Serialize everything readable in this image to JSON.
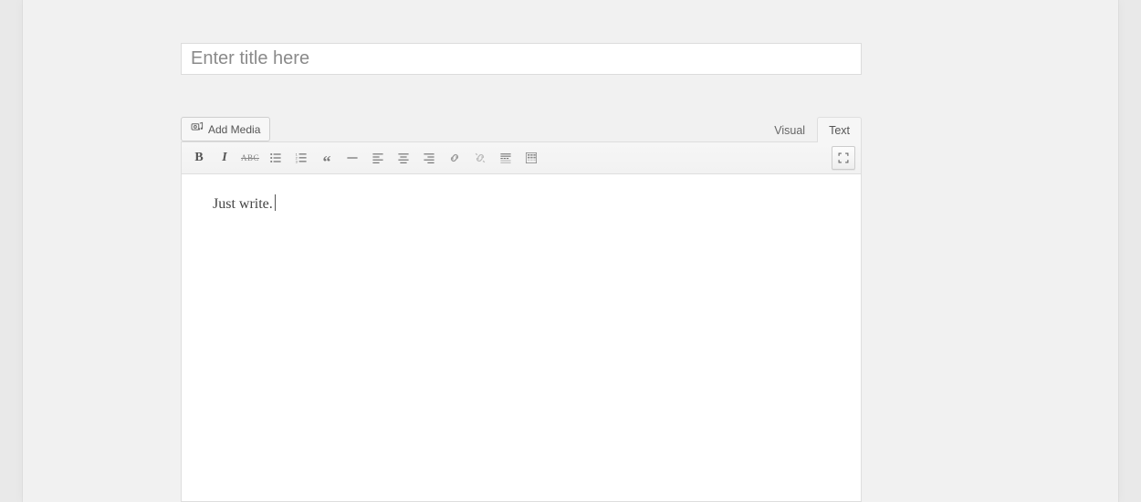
{
  "title": {
    "value": "",
    "placeholder": "Enter title here"
  },
  "media_button": {
    "label": "Add Media"
  },
  "tabs": {
    "visual": "Visual",
    "text": "Text",
    "active": "visual"
  },
  "toolbar": {
    "buttons": [
      "bold",
      "italic",
      "strikethrough",
      "bullet-list",
      "numbered-list",
      "blockquote",
      "horizontal-rule",
      "align-left",
      "align-center",
      "align-right",
      "insert-link",
      "unlink",
      "insert-more",
      "toolbar-toggle"
    ],
    "fullscreen": "fullscreen"
  },
  "content": {
    "body": "Just write."
  }
}
